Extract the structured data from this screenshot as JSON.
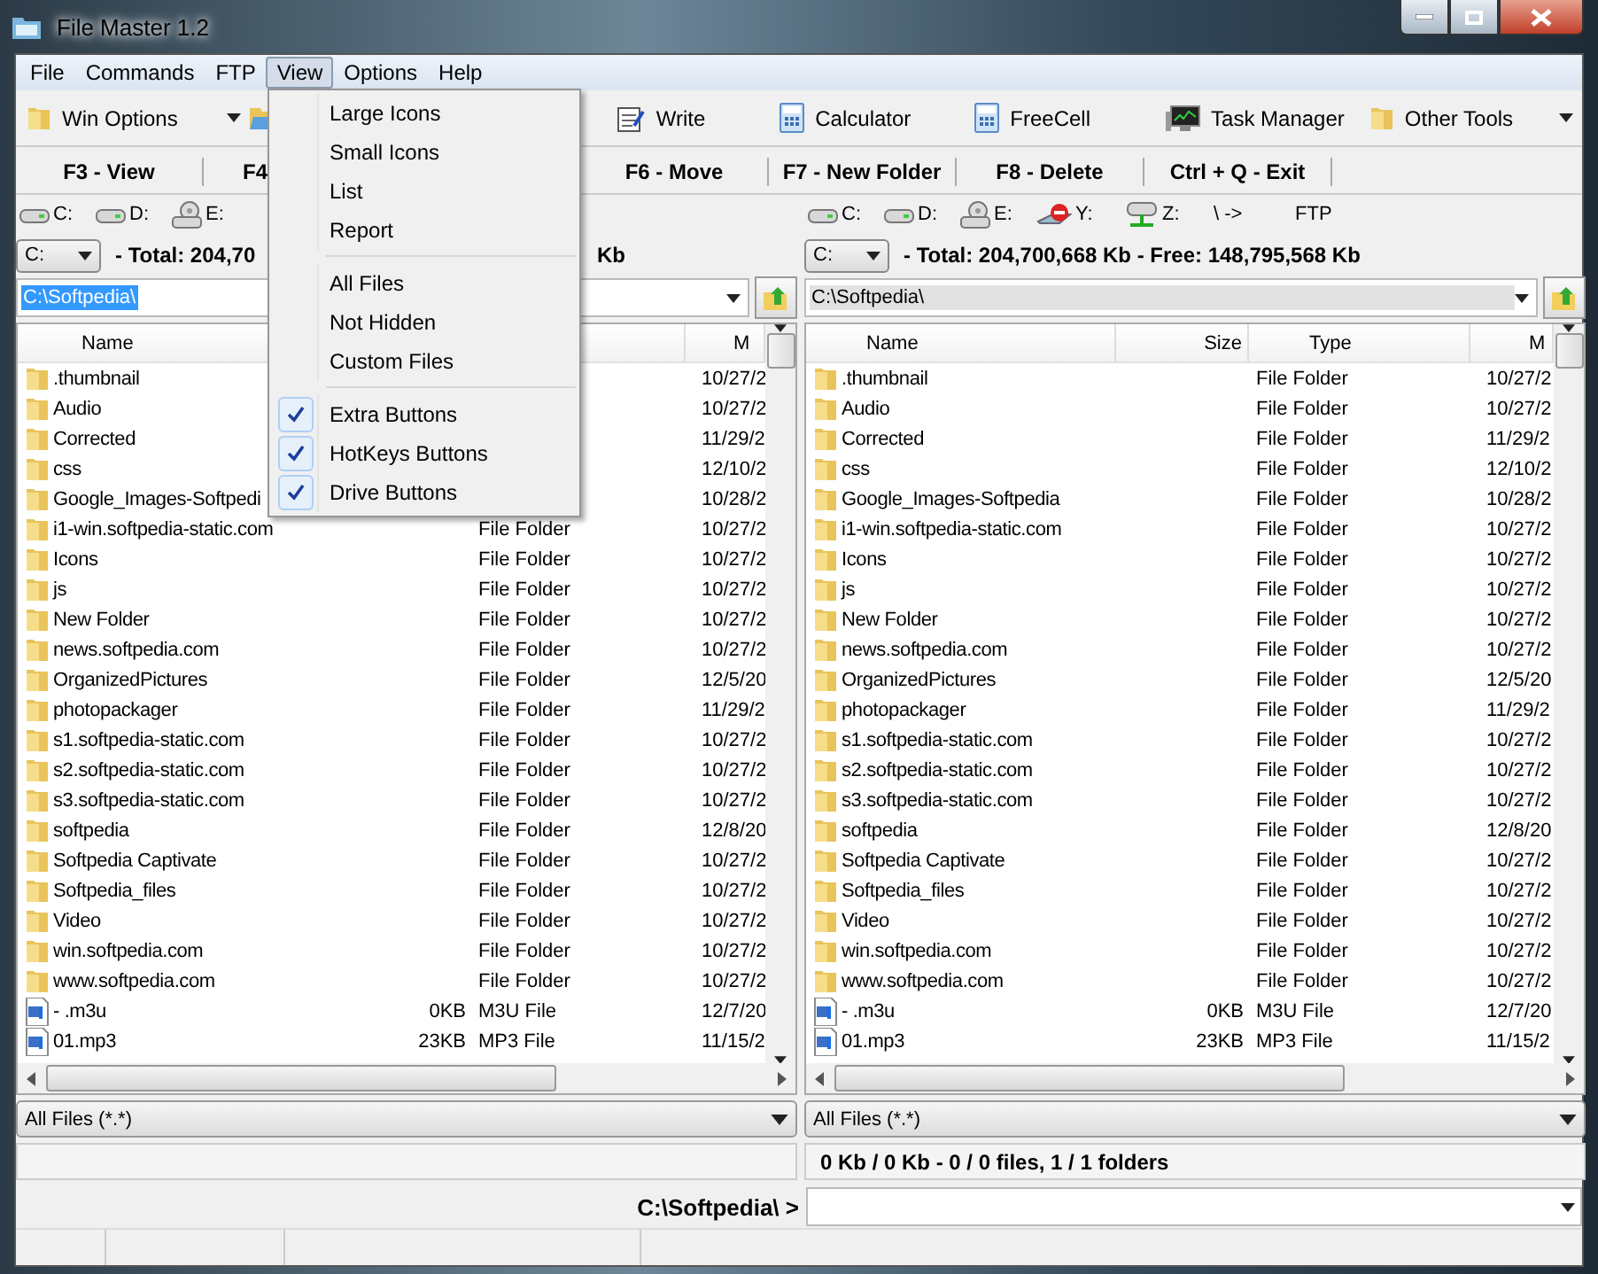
{
  "window": {
    "title": "File Master 1.2"
  },
  "menu_bar": [
    {
      "label": "File",
      "selected": false
    },
    {
      "label": "Commands",
      "selected": false
    },
    {
      "label": "FTP",
      "selected": false
    },
    {
      "label": "View",
      "selected": true
    },
    {
      "label": "Options",
      "selected": false
    },
    {
      "label": "Help",
      "selected": false
    }
  ],
  "view_menu": [
    {
      "kind": "item",
      "label": "Large Icons",
      "checked": false
    },
    {
      "kind": "item",
      "label": "Small Icons",
      "checked": false
    },
    {
      "kind": "item",
      "label": "List",
      "checked": false
    },
    {
      "kind": "item",
      "label": "Report",
      "checked": false
    },
    {
      "kind": "separator"
    },
    {
      "kind": "item",
      "label": "All Files",
      "checked": false
    },
    {
      "kind": "item",
      "label": "Not Hidden",
      "checked": false
    },
    {
      "kind": "item",
      "label": "Custom Files",
      "checked": false
    },
    {
      "kind": "separator"
    },
    {
      "kind": "item",
      "label": "Extra Buttons",
      "checked": true
    },
    {
      "kind": "item",
      "label": "HotKeys Buttons",
      "checked": true
    },
    {
      "kind": "item",
      "label": "Drive Buttons",
      "checked": true
    }
  ],
  "toolbar": {
    "left": [
      {
        "kind": "folder",
        "label": "Win Options",
        "dropdown": true
      },
      {
        "kind": "folder-open"
      }
    ],
    "right": [
      {
        "kind": "notepad",
        "label": "Write"
      },
      {
        "kind": "calculator",
        "label": "Calculator"
      },
      {
        "kind": "calculator",
        "label": "FreeCell"
      },
      {
        "kind": "monitor",
        "label": "Task Manager"
      },
      {
        "kind": "folder",
        "label": "Other Tools",
        "dropdown": true
      }
    ]
  },
  "hotkeys": [
    {
      "label": "F3 - View"
    },
    {
      "label": "F4"
    },
    {
      "label": "F6 - Move"
    },
    {
      "label": "F7 - New Folder"
    },
    {
      "label": "F8 - Delete"
    },
    {
      "label": "Ctrl + Q - Exit"
    }
  ],
  "panels": [
    {
      "drives": [
        {
          "kind": "hdd",
          "label": "C:"
        },
        {
          "kind": "hdd",
          "label": "D:"
        },
        {
          "kind": "cdrom",
          "label": "E:"
        }
      ],
      "drive_select": "C:",
      "total": [
        "- Total: 204,70",
        "Kb"
      ],
      "path": "C:\\Softpedia\\",
      "path_selected": true,
      "columns": [
        "Name",
        "M"
      ],
      "rows": [
        {
          "kind": "folder",
          "name": ".thumbnail",
          "date": "10/27/2"
        },
        {
          "kind": "folder",
          "name": "Audio",
          "date": "10/27/2"
        },
        {
          "kind": "folder",
          "name": "Corrected",
          "date": "11/29/2"
        },
        {
          "kind": "folder",
          "name": "css",
          "date": "12/10/2"
        },
        {
          "kind": "folder",
          "name": "Google_Images-Softpedi",
          "date": "10/28/2"
        },
        {
          "kind": "folder",
          "name": "i1-win.softpedia-static.com",
          "type": "File Folder",
          "date": "10/27/2"
        },
        {
          "kind": "folder",
          "name": "Icons",
          "type": "File Folder",
          "date": "10/27/2"
        },
        {
          "kind": "folder",
          "name": "js",
          "type": "File Folder",
          "date": "10/27/2"
        },
        {
          "kind": "folder",
          "name": "New Folder",
          "type": "File Folder",
          "date": "10/27/2"
        },
        {
          "kind": "folder",
          "name": "news.softpedia.com",
          "type": "File Folder",
          "date": "10/27/2"
        },
        {
          "kind": "folder",
          "name": "OrganizedPictures",
          "type": "File Folder",
          "date": "12/5/20"
        },
        {
          "kind": "folder",
          "name": "photopackager",
          "type": "File Folder",
          "date": "11/29/2"
        },
        {
          "kind": "folder",
          "name": "s1.softpedia-static.com",
          "type": "File Folder",
          "date": "10/27/2"
        },
        {
          "kind": "folder",
          "name": "s2.softpedia-static.com",
          "type": "File Folder",
          "date": "10/27/2"
        },
        {
          "kind": "folder",
          "name": "s3.softpedia-static.com",
          "type": "File Folder",
          "date": "10/27/2"
        },
        {
          "kind": "folder",
          "name": "softpedia",
          "type": "File Folder",
          "date": "12/8/20"
        },
        {
          "kind": "folder",
          "name": "Softpedia Captivate",
          "type": "File Folder",
          "date": "10/27/2"
        },
        {
          "kind": "folder",
          "name": "Softpedia_files",
          "type": "File Folder",
          "date": "10/27/2"
        },
        {
          "kind": "folder",
          "name": "Video",
          "type": "File Folder",
          "date": "10/27/2"
        },
        {
          "kind": "folder",
          "name": "win.softpedia.com",
          "type": "File Folder",
          "date": "10/27/2"
        },
        {
          "kind": "folder",
          "name": "www.softpedia.com",
          "type": "File Folder",
          "date": "10/27/2"
        },
        {
          "kind": "audio",
          "name": "- .m3u",
          "size": "0KB",
          "type": "M3U File",
          "date": "12/7/20"
        },
        {
          "kind": "audio",
          "name": "01.mp3",
          "size": "23KB",
          "type": "MP3 File",
          "date": "11/15/2"
        }
      ],
      "filter": "All Files (*.*)"
    },
    {
      "drives": [
        {
          "kind": "hdd",
          "label": "C:"
        },
        {
          "kind": "hdd",
          "label": "D:"
        },
        {
          "kind": "cdrom",
          "label": "E:"
        },
        {
          "kind": "net-off",
          "label": "Y:"
        },
        {
          "kind": "net",
          "label": "Z:"
        },
        {
          "kind": "text",
          "label": "\\ ->"
        },
        {
          "kind": "text",
          "label": "FTP"
        }
      ],
      "drive_select": "C:",
      "total": [
        "- Total: 204,700,668 Kb - Free: 148,795,568 Kb"
      ],
      "path": "C:\\Softpedia\\",
      "path_selected": false,
      "columns": [
        "Name",
        "Size",
        "Type",
        "M"
      ],
      "rows": [
        {
          "kind": "folder",
          "name": ".thumbnail",
          "type": "File Folder",
          "date": "10/27/2"
        },
        {
          "kind": "folder",
          "name": "Audio",
          "type": "File Folder",
          "date": "10/27/2"
        },
        {
          "kind": "folder",
          "name": "Corrected",
          "type": "File Folder",
          "date": "11/29/2"
        },
        {
          "kind": "folder",
          "name": "css",
          "type": "File Folder",
          "date": "12/10/2"
        },
        {
          "kind": "folder",
          "name": "Google_Images-Softpedia",
          "type": "File Folder",
          "date": "10/28/2"
        },
        {
          "kind": "folder",
          "name": "i1-win.softpedia-static.com",
          "type": "File Folder",
          "date": "10/27/2"
        },
        {
          "kind": "folder",
          "name": "Icons",
          "type": "File Folder",
          "date": "10/27/2"
        },
        {
          "kind": "folder",
          "name": "js",
          "type": "File Folder",
          "date": "10/27/2"
        },
        {
          "kind": "folder",
          "name": "New Folder",
          "type": "File Folder",
          "date": "10/27/2"
        },
        {
          "kind": "folder",
          "name": "news.softpedia.com",
          "type": "File Folder",
          "date": "10/27/2"
        },
        {
          "kind": "folder",
          "name": "OrganizedPictures",
          "type": "File Folder",
          "date": "12/5/20"
        },
        {
          "kind": "folder",
          "name": "photopackager",
          "type": "File Folder",
          "date": "11/29/2"
        },
        {
          "kind": "folder",
          "name": "s1.softpedia-static.com",
          "type": "File Folder",
          "date": "10/27/2"
        },
        {
          "kind": "folder",
          "name": "s2.softpedia-static.com",
          "type": "File Folder",
          "date": "10/27/2"
        },
        {
          "kind": "folder",
          "name": "s3.softpedia-static.com",
          "type": "File Folder",
          "date": "10/27/2"
        },
        {
          "kind": "folder",
          "name": "softpedia",
          "type": "File Folder",
          "date": "12/8/20"
        },
        {
          "kind": "folder",
          "name": "Softpedia Captivate",
          "type": "File Folder",
          "date": "10/27/2"
        },
        {
          "kind": "folder",
          "name": "Softpedia_files",
          "type": "File Folder",
          "date": "10/27/2"
        },
        {
          "kind": "folder",
          "name": "Video",
          "type": "File Folder",
          "date": "10/27/2"
        },
        {
          "kind": "folder",
          "name": "win.softpedia.com",
          "type": "File Folder",
          "date": "10/27/2"
        },
        {
          "kind": "folder",
          "name": "www.softpedia.com",
          "type": "File Folder",
          "date": "10/27/2"
        },
        {
          "kind": "audio",
          "name": "- .m3u",
          "size": "0KB",
          "type": "M3U File",
          "date": "12/7/20"
        },
        {
          "kind": "audio",
          "name": "01.mp3",
          "size": "23KB",
          "type": "MP3 File",
          "date": "11/15/2"
        }
      ],
      "filter": "All Files (*.*)",
      "status": "0 Kb / 0 Kb - 0 / 0 files, 1 / 1 folders"
    }
  ],
  "command_line": {
    "prompt": "C:\\Softpedia\\ >"
  }
}
